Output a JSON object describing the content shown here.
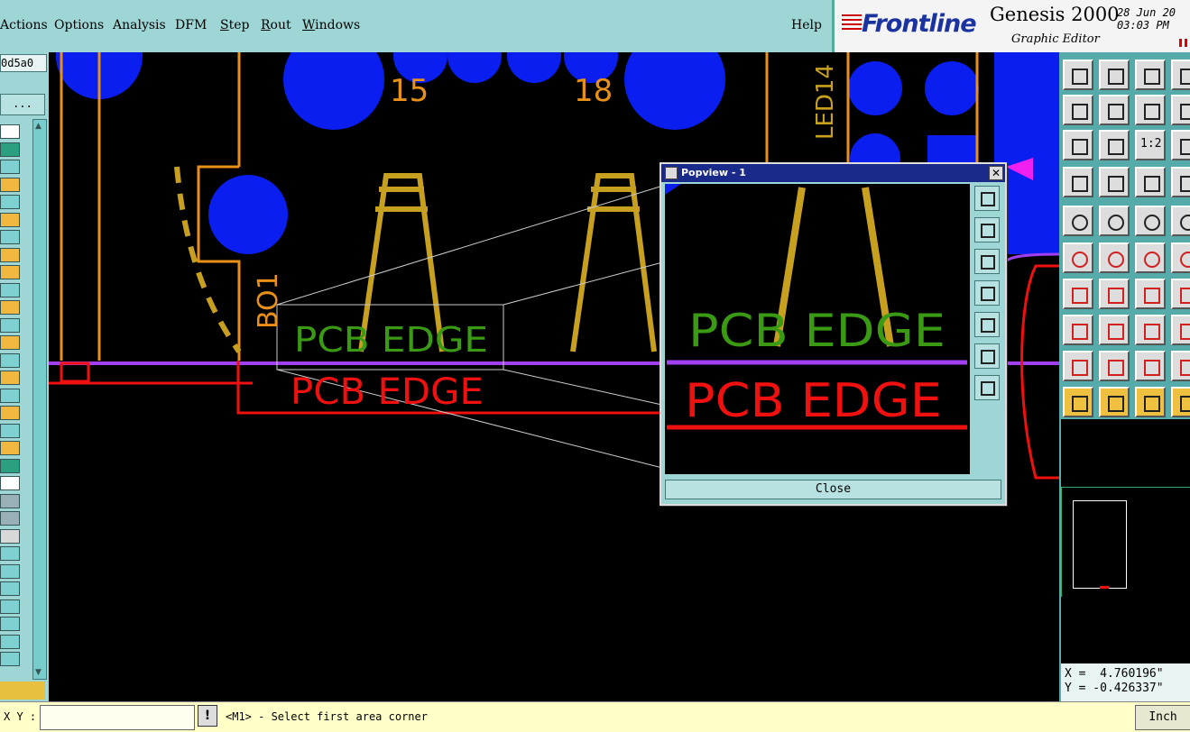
{
  "menu": {
    "items": [
      "Actions",
      "Options",
      "Analysis",
      "DFM",
      "Step",
      "Rout",
      "Windows"
    ],
    "help": "Help"
  },
  "header": {
    "logo": "Frontline",
    "product": "Genesis 2000",
    "subtitle": "Graphic Editor",
    "date": "28 Jun 20",
    "time": "03:03 PM"
  },
  "left_panel": {
    "id_value": "0d5a0",
    "browse_label": "...",
    "swatches": [
      "#ffffff",
      "#2aa080",
      "#7fd0d0",
      "#f0b840",
      "#7fd0d0",
      "#f0b840",
      "#7fd0d0",
      "#f0b840",
      "#f0b840",
      "#7fd0d0",
      "#f0b840",
      "#7fd0d0",
      "#f0b840",
      "#7fd0d0",
      "#f0b840",
      "#7fd0d0",
      "#f0b840",
      "#7fd0d0",
      "#f0b840",
      "#2aa080",
      "#ffffff",
      "#9ab0b8",
      "#9ab0b8",
      "#d8d8d8",
      "#7fd0d0",
      "#7fd0d0",
      "#7fd0d0",
      "#7fd0d0",
      "#7fd0d0",
      "#7fd0d0",
      "#7fd0d0"
    ]
  },
  "canvas": {
    "labels": {
      "pad15": "15",
      "pad18": "18",
      "led": "LED14",
      "bo": "BO1",
      "edge_green": "PCB  EDGE",
      "edge_red": "PCB  EDGE"
    },
    "colors": {
      "pad": "#0a1ef0",
      "trace": "#c8a020",
      "outline": "#e89018",
      "green": "#3a9a14",
      "red": "#f01010",
      "purple": "#a040f0"
    }
  },
  "popview": {
    "title": "Popview - 1",
    "close_label": "Close",
    "tools": [
      "zoom-box-icon",
      "pan-up-icon",
      "pan-down-icon",
      "pan-left-icon",
      "pan-right-icon",
      "fit-icon",
      "zoom-out-icon"
    ],
    "labels": {
      "edge_green": "PCB  EDGE",
      "edge_red": "PCB  EDGE"
    }
  },
  "right_panel": {
    "ratio_label": "1:2",
    "coord_x": "X =  4.760196\"",
    "coord_y": "Y = -0.426337\""
  },
  "status": {
    "xy_label": "X Y :",
    "input_value": "",
    "warn": "!",
    "message": "<M1> - Select first area corner",
    "unit": "Inch"
  }
}
